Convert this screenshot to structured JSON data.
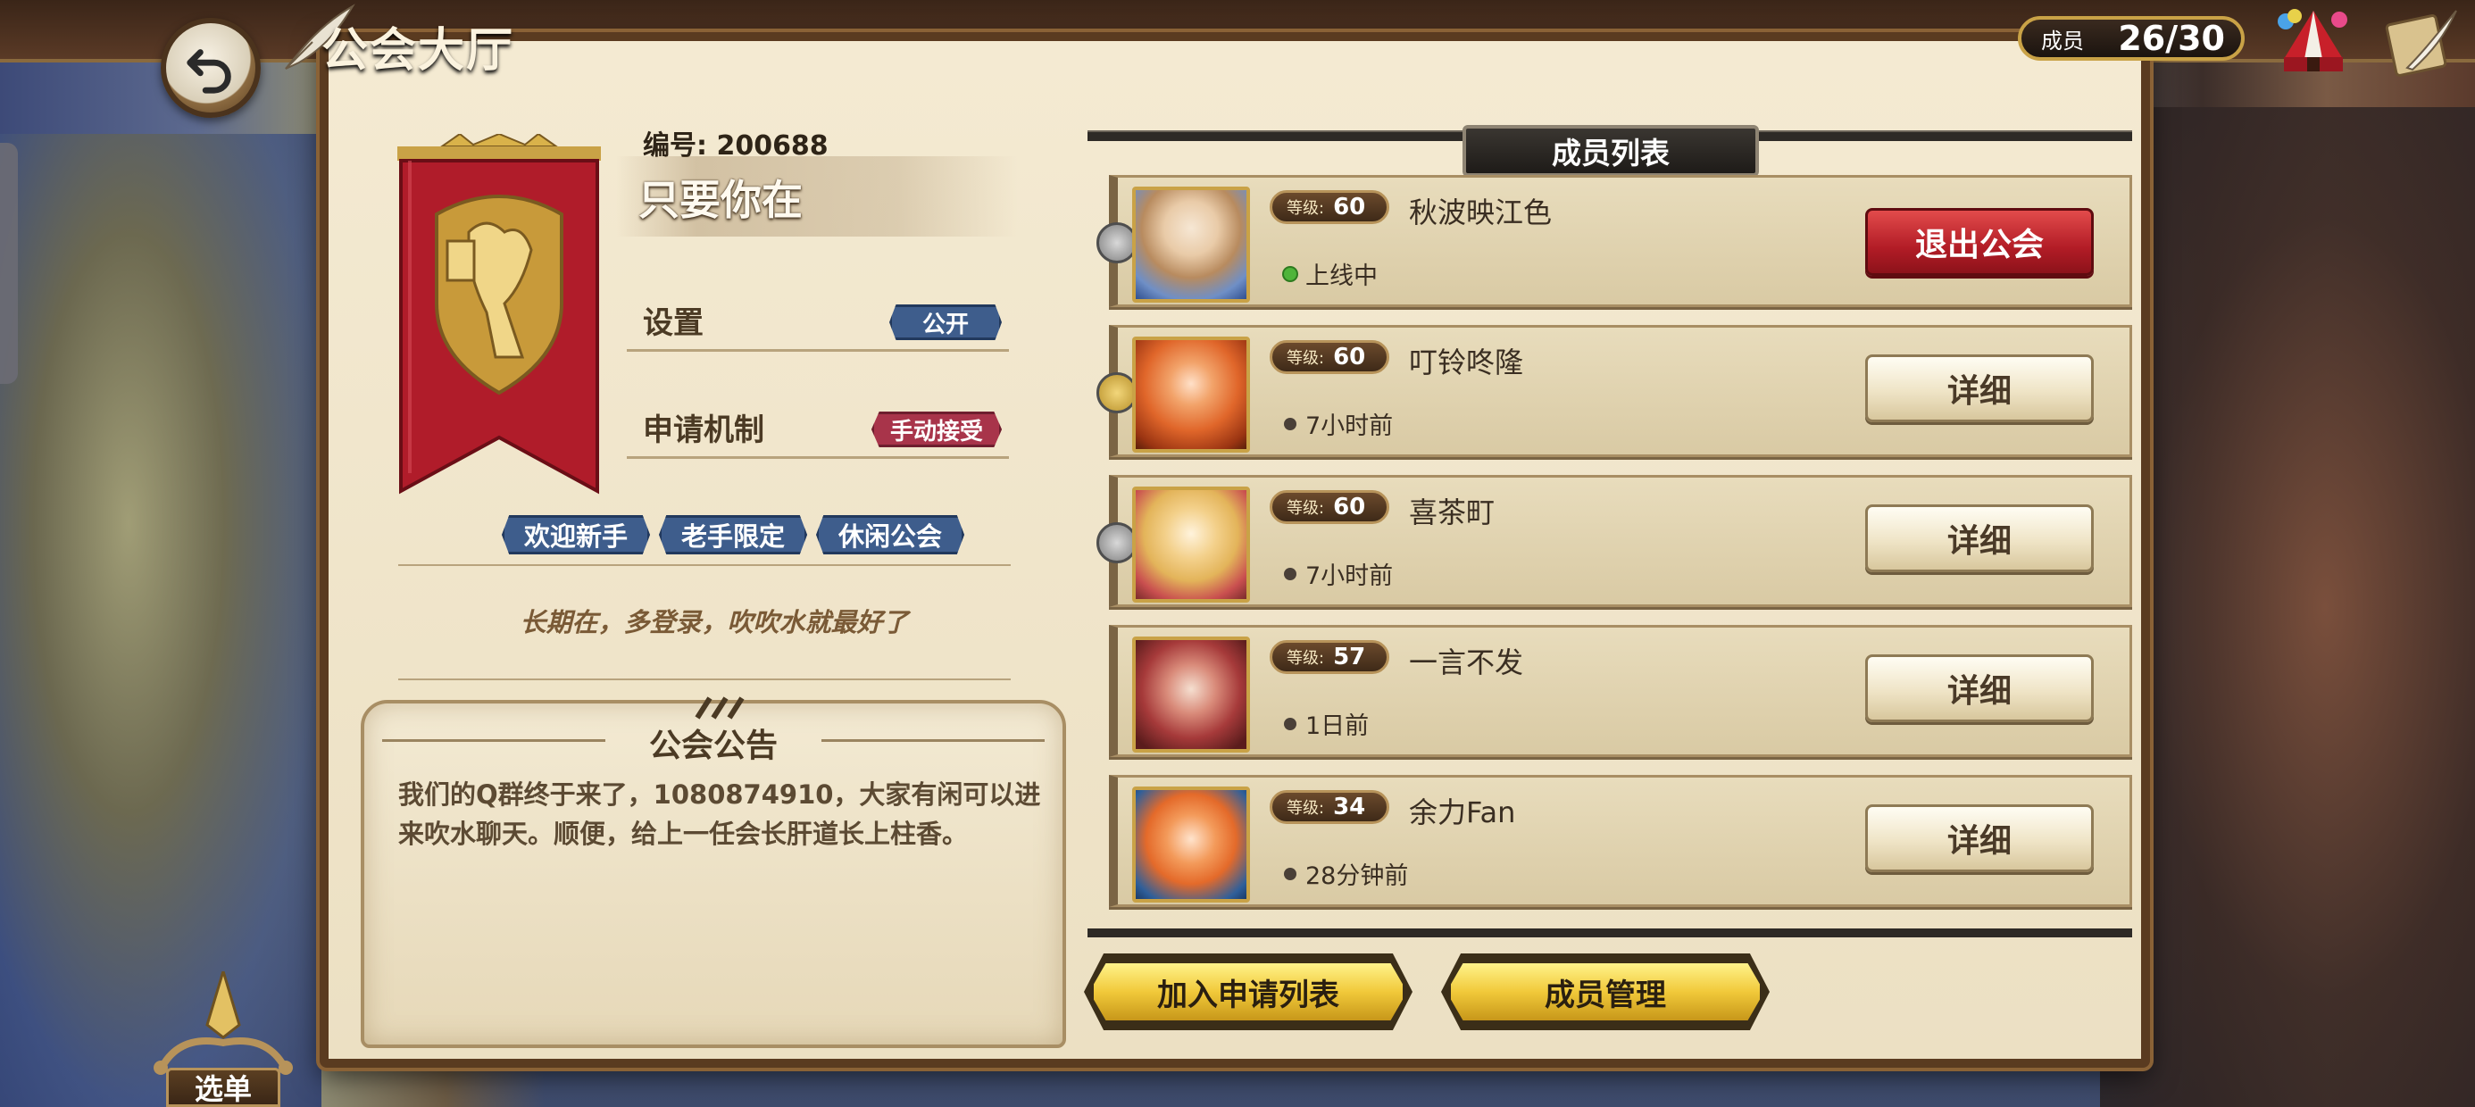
{
  "header": {
    "title": "公会大厅",
    "member_label": "成员",
    "member_count": "26/30"
  },
  "guild": {
    "id_label": "编号: 200688",
    "name": "只要你在",
    "settings": [
      {
        "key": "设置",
        "value": "公开"
      },
      {
        "key": "申请机制",
        "value": "手动接受"
      }
    ],
    "tags": [
      "欢迎新手",
      "老手限定",
      "休闲公会"
    ],
    "motto": "长期在，多登录，吹吹水就最好了",
    "notice_title": "公会公告",
    "notice_body": "我们的Q群终于来了，1080874910，大家有闲可以进来吹水聊天。顺便，给上一任会长肝道长上柱香。"
  },
  "members": {
    "title": "成员列表",
    "level_label": "等级:",
    "rows": [
      {
        "level": "60",
        "name": "秋波映江色",
        "status": "上线中",
        "online": true,
        "action": "退出公会"
      },
      {
        "level": "60",
        "name": "叮铃咚隆",
        "status": "7小时前",
        "online": false,
        "action": "详细"
      },
      {
        "level": "60",
        "name": "喜茶町",
        "status": "7小时前",
        "online": false,
        "action": "详细"
      },
      {
        "level": "57",
        "name": "一言不发",
        "status": "1日前",
        "online": false,
        "action": "详细"
      },
      {
        "level": "34",
        "name": "余力Fan",
        "status": "28分钟前",
        "online": false,
        "action": "详细"
      }
    ]
  },
  "footer": {
    "join_list": "加入申请列表",
    "manage": "成员管理",
    "menu": "选单"
  },
  "colors": {
    "panel": "#f1e6cd",
    "accent_gold": "#f1c93a",
    "quit_red": "#b21c26",
    "tag_blue": "#3e5d8c"
  }
}
